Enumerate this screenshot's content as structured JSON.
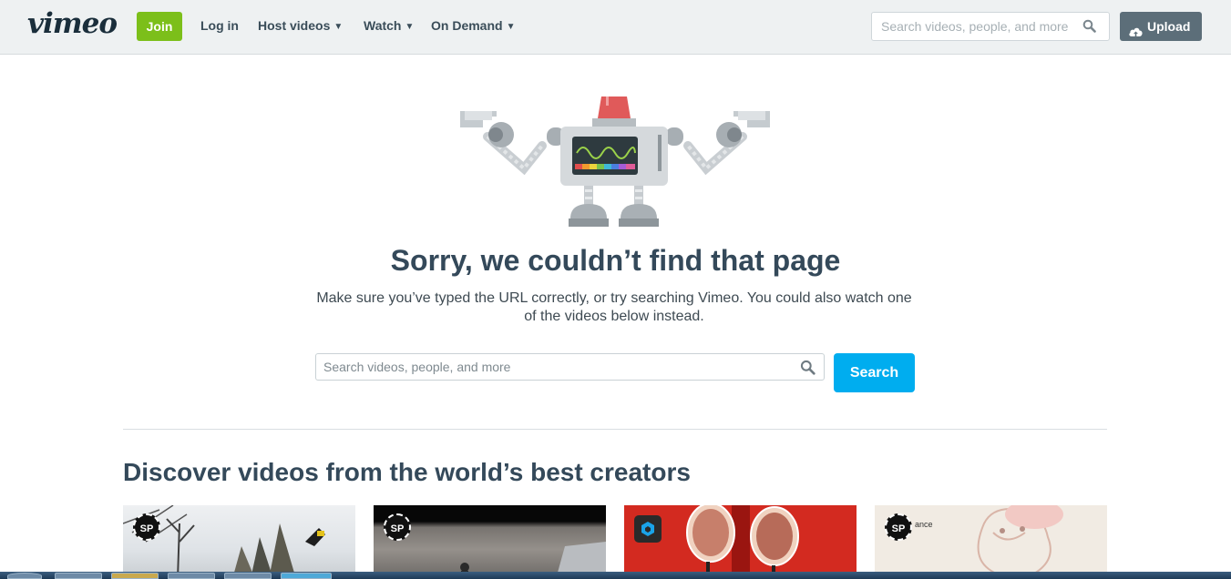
{
  "header": {
    "logo": "vimeo",
    "join_label": "Join",
    "login_label": "Log in",
    "nav": [
      {
        "label": "Host videos"
      },
      {
        "label": "Watch"
      },
      {
        "label": "On Demand"
      }
    ],
    "search_placeholder": "Search videos, people, and more",
    "upload_label": "Upload"
  },
  "error": {
    "title": "Sorry, we couldn’t find that page",
    "message_line1": "Make sure you’ve typed the URL correctly, or try searching Vimeo. You could also watch one",
    "message_line2": "of the videos below instead.",
    "search_placeholder": "Search videos, people, and more",
    "search_button": "Search"
  },
  "discover": {
    "title": "Discover videos from the world’s best creators",
    "videos": [
      {
        "badge": "SP"
      },
      {
        "badge": "SP"
      },
      {
        "badge": ""
      },
      {
        "badge": "SP",
        "overlay_text": "ance"
      }
    ]
  },
  "colors": {
    "join_green": "#7cbf1a",
    "search_blue": "#00adef",
    "upload_gray": "#5c6e79",
    "heading": "#34495a"
  }
}
